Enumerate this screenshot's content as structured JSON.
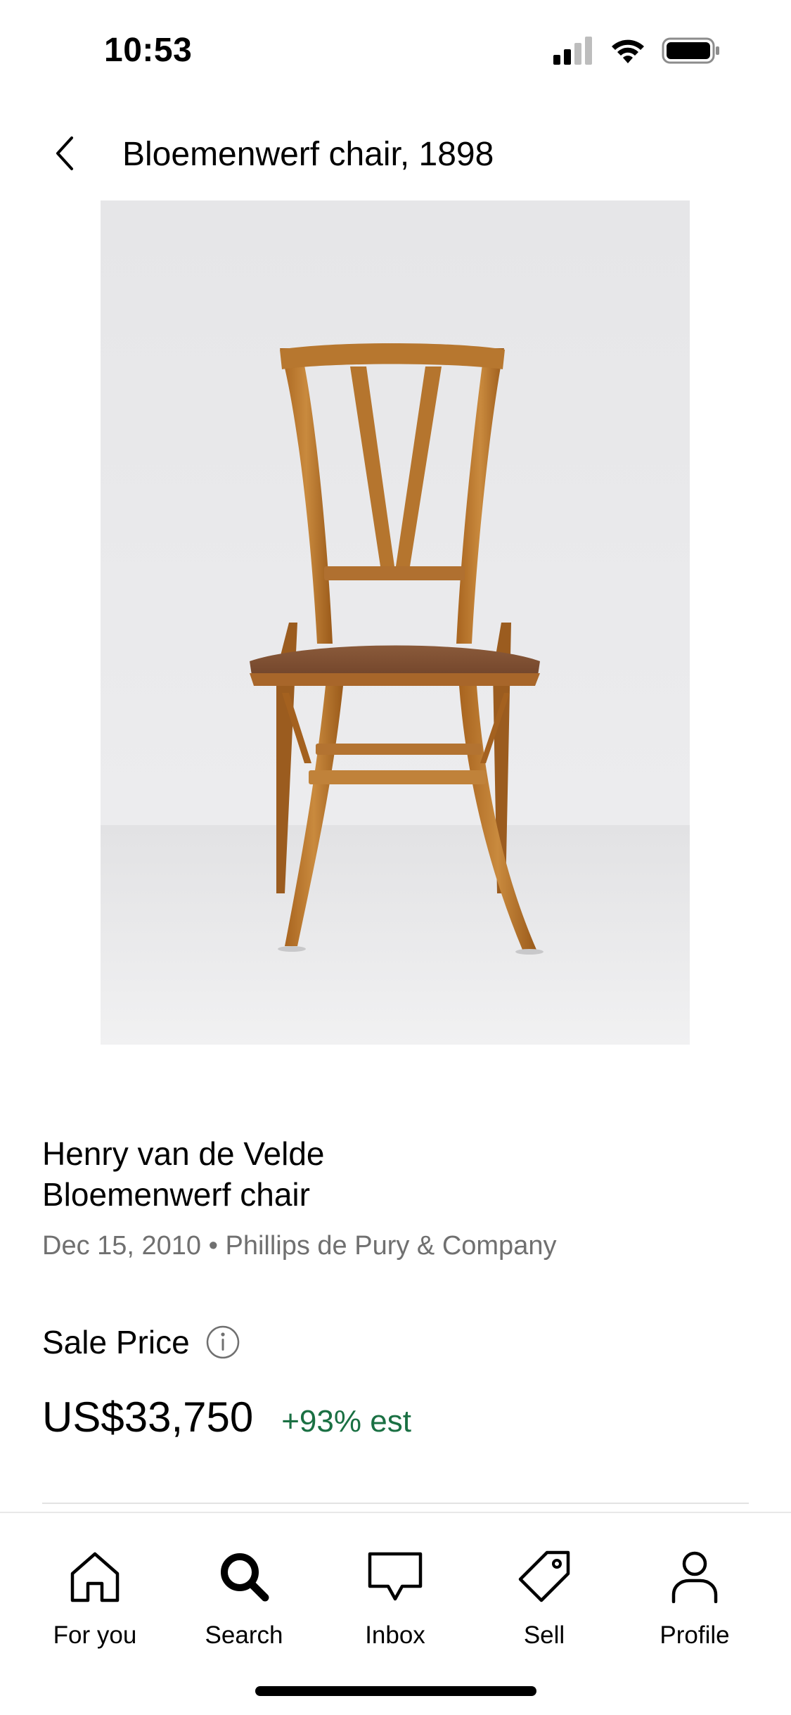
{
  "status_bar": {
    "time": "10:53"
  },
  "header": {
    "title": "Bloemenwerf chair, 1898"
  },
  "artwork": {
    "icon": "chair-photo"
  },
  "details": {
    "artist": "Henry van de Velde",
    "title": "Bloemenwerf chair",
    "sale_meta": "Dec 15, 2010 • Phillips de Pury & Company",
    "sale_price_label": "Sale Price",
    "price": "US$33,750",
    "price_change": "+93% est"
  },
  "colors": {
    "positive": "#1a7043",
    "muted": "#707070"
  },
  "tab_bar": {
    "items": [
      {
        "label": "For you",
        "icon": "home-icon"
      },
      {
        "label": "Search",
        "icon": "search-icon"
      },
      {
        "label": "Inbox",
        "icon": "message-icon"
      },
      {
        "label": "Sell",
        "icon": "tag-icon"
      },
      {
        "label": "Profile",
        "icon": "person-icon"
      }
    ],
    "active": "Search"
  }
}
